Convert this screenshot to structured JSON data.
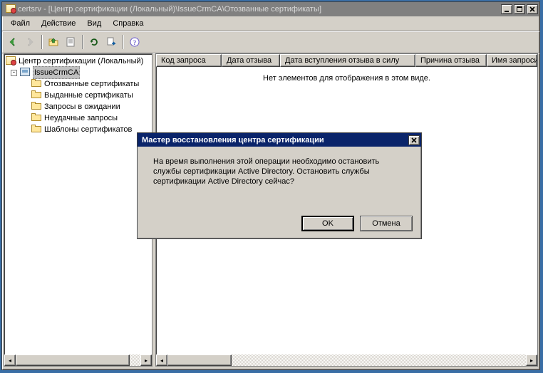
{
  "window": {
    "app_name": "certsrv",
    "title_path": "[Центр сертификации (Локальный)\\IssueCrmCA\\Отозванные сертификаты]",
    "sys_min": "_",
    "sys_max": "❐",
    "sys_close": "✕"
  },
  "menu": {
    "file": "Файл",
    "action": "Действие",
    "view": "Вид",
    "help": "Справка"
  },
  "toolbar": {
    "back": "back",
    "forward": "forward",
    "up": "up",
    "props": "properties",
    "refresh": "refresh",
    "export": "export",
    "help": "help"
  },
  "tree": {
    "root": "Центр сертификации (Локальный)",
    "ca_node": "IssueCrmCA",
    "items": [
      "Отозванные сертификаты",
      "Выданные сертификаты",
      "Запросы в ожидании",
      "Неудачные запросы",
      "Шаблоны сертификатов"
    ]
  },
  "list": {
    "columns": [
      "Код запроса",
      "Дата отзыва",
      "Дата вступления отзыва в силу",
      "Причина отзыва",
      "Имя запросив"
    ],
    "empty_text": "Нет элементов для отображения в этом виде."
  },
  "dialog": {
    "title": "Мастер восстановления центра сертификации",
    "body": "На время выполнения этой операции необходимо остановить службы сертификации Active Directory. Остановить службы сертификации Active Directory сейчас?",
    "ok": "OK",
    "cancel": "Отмена",
    "close_x": "✕"
  }
}
